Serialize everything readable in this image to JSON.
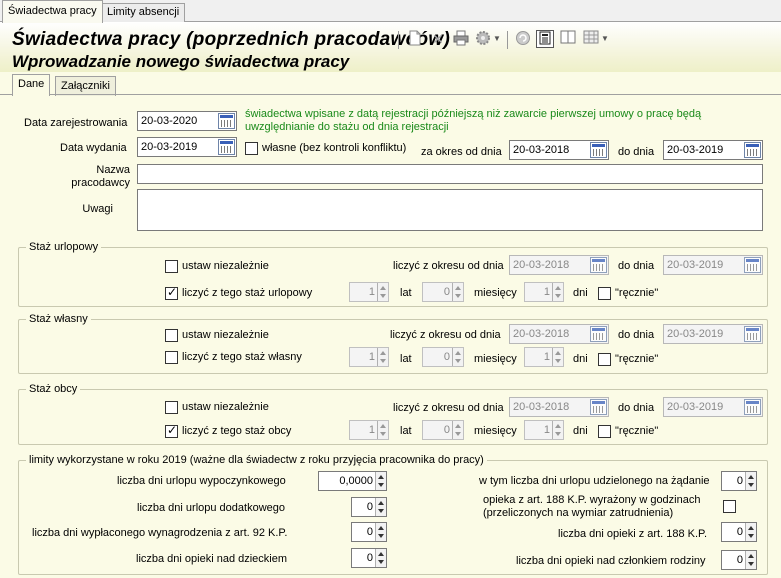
{
  "outer_tabs": [
    "Świadectwa pracy",
    "Limity absencji"
  ],
  "header": {
    "title": "Świadectwa pracy (poprzednich pracodawców)",
    "subtitle": "Wprowadzanie nowego świadectwa pracy",
    "toolbar_icons": [
      "new-document-icon",
      "delete-icon",
      "print-icon",
      "settings-gear-icon",
      "dropdown-arrow-icon",
      "refresh-icon",
      "calculator-icon",
      "split-view-icon",
      "grid-icon",
      "dropdown-arrow-icon"
    ]
  },
  "inner_tabs": [
    "Dane",
    "Załączniki"
  ],
  "form": {
    "data_zarejestrowania_label": "Data zarejestrowania",
    "data_zarejestrowania": "20-03-2020",
    "info_text_1": "świadectwa wpisane z datą rejestracji późniejszą niż zawarcie pierwszej umowy o pracę będą",
    "info_text_2": "uwzględnianie do stażu od dnia rejestracji",
    "data_wydania_label": "Data wydania",
    "data_wydania": "20-03-2019",
    "wlasne_label": "własne (bez kontroli konfliktu)",
    "okres_od_label": "za okres od dnia",
    "okres_od": "20-03-2018",
    "okres_do_label": "do dnia",
    "okres_do": "20-03-2019",
    "nazwa_label_1": "Nazwa",
    "nazwa_label_2": "pracodawcy",
    "nazwa_value": "",
    "uwagi_label": "Uwagi",
    "uwagi_value": ""
  },
  "staz_urlopowy": {
    "title": "Staż urlopowy",
    "ustaw_label": "ustaw niezależnie",
    "liczyc_okres_label": "liczyć z okresu od dnia",
    "od": "20-03-2018",
    "do_label": "do dnia",
    "do": "20-03-2019",
    "liczyc_staz_label": "liczyć z tego staż urlopowy",
    "lat": "1",
    "lat_label": "lat",
    "miesiecy": "0",
    "miesiecy_label": "miesięcy",
    "dni": "1",
    "dni_label": "dni",
    "recznie_label": "\"ręcznie\""
  },
  "staz_wlasny": {
    "title": "Staż własny",
    "ustaw_label": "ustaw niezależnie",
    "liczyc_okres_label": "liczyć z okresu od dnia",
    "od": "20-03-2018",
    "do_label": "do dnia",
    "do": "20-03-2019",
    "liczyc_staz_label": "liczyć z tego staż własny",
    "lat": "1",
    "lat_label": "lat",
    "miesiecy": "0",
    "miesiecy_label": "miesięcy",
    "dni": "1",
    "dni_label": "dni",
    "recznie_label": "\"ręcznie\""
  },
  "staz_obcy": {
    "title": "Staż obcy",
    "ustaw_label": "ustaw niezależnie",
    "liczyc_okres_label": "liczyć z okresu od dnia",
    "od": "20-03-2018",
    "do_label": "do dnia",
    "do": "20-03-2019",
    "liczyc_staz_label": "liczyć z tego staż obcy",
    "lat": "1",
    "lat_label": "lat",
    "miesiecy": "0",
    "miesiecy_label": "miesięcy",
    "dni": "1",
    "dni_label": "dni",
    "recznie_label": "\"ręcznie\""
  },
  "limity": {
    "title": "limity wykorzystane w roku 2019 (ważne dla świadectw z roku przyjęcia pracownika do pracy)",
    "urlop_wypoczynkowy_label": "liczba dni urlopu wypoczynkowego",
    "urlop_wypoczynkowy": "0,0000",
    "urlop_dodatkowy_label": "liczba dni urlopu dodatkowego",
    "urlop_dodatkowy": "0",
    "wynagrodzenie_92_label": "liczba dni wypłaconego wynagrodzenia z art. 92 K.P.",
    "wynagrodzenie_92": "0",
    "opieka_dziecko_label": "liczba dni opieki nad dzieckiem",
    "opieka_dziecko": "0",
    "urlop_zadanie_label": "w tym liczba dni urlopu udzielonego na żądanie",
    "urlop_zadanie": "0",
    "opieka_188_godz_label_1": "opieka z art. 188 K.P. wyrażony w godzinach",
    "opieka_188_godz_label_2": "(przeliczonych na wymiar zatrudnienia)",
    "opieka_188_label": "liczba dni opieki z art. 188 K.P.",
    "opieka_188": "0",
    "opieka_rodzina_label": "liczba dni opieki nad członkiem rodziny",
    "opieka_rodzina": "0"
  }
}
